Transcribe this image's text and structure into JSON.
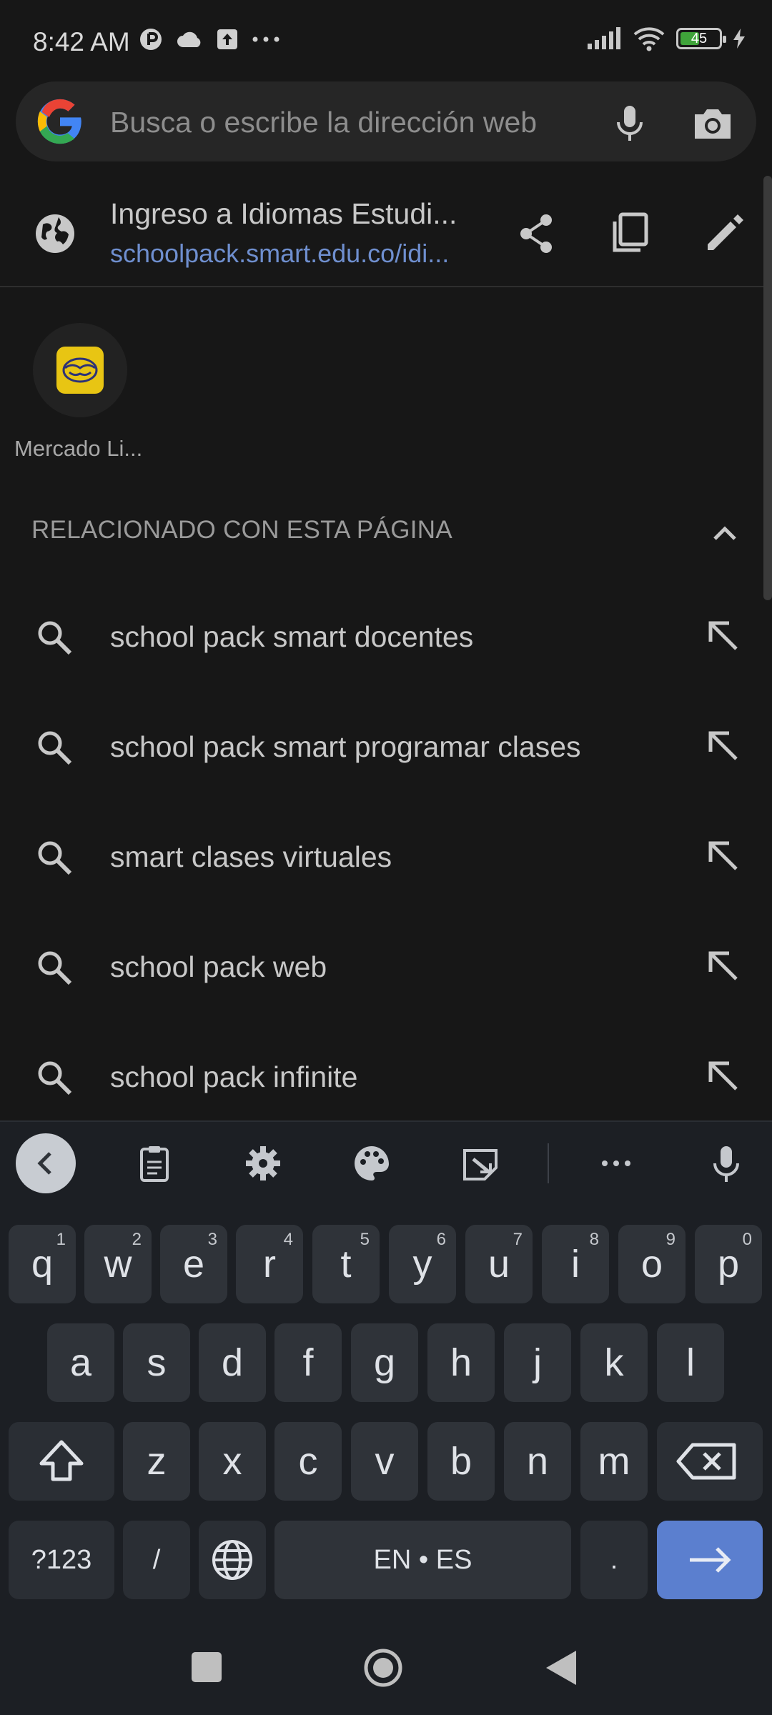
{
  "status_bar": {
    "time": "8:42 AM",
    "battery_percent": "45",
    "icons_left": [
      "privacy-icon",
      "cloud-icon",
      "upload-icon",
      "more-icon"
    ],
    "icons_right": [
      "signal-icon",
      "wifi-icon",
      "battery-icon",
      "charging-icon"
    ]
  },
  "search": {
    "placeholder": "Busca o escribe la dirección web"
  },
  "current_page": {
    "title": "Ingreso a Idiomas Estudi...",
    "url": "schoolpack.smart.edu.co/idi..."
  },
  "tiles": [
    {
      "label": "Mercado Li...",
      "color": "#e8c513"
    }
  ],
  "section": {
    "title": "RELACIONADO CON ESTA PÁGINA"
  },
  "suggestions": [
    {
      "text": "school pack smart docentes"
    },
    {
      "text": "school pack smart programar clases"
    },
    {
      "text": "smart clases virtuales"
    },
    {
      "text": "school pack web"
    },
    {
      "text": "school pack infinite"
    }
  ],
  "keyboard": {
    "row1": [
      {
        "k": "q",
        "s": "1"
      },
      {
        "k": "w",
        "s": "2"
      },
      {
        "k": "e",
        "s": "3"
      },
      {
        "k": "r",
        "s": "4"
      },
      {
        "k": "t",
        "s": "5"
      },
      {
        "k": "y",
        "s": "6"
      },
      {
        "k": "u",
        "s": "7"
      },
      {
        "k": "i",
        "s": "8"
      },
      {
        "k": "o",
        "s": "9"
      },
      {
        "k": "p",
        "s": "0"
      }
    ],
    "row2": [
      "a",
      "s",
      "d",
      "f",
      "g",
      "h",
      "j",
      "k",
      "l"
    ],
    "row3": [
      "z",
      "x",
      "c",
      "v",
      "b",
      "n",
      "m"
    ],
    "symbols_label": "?123",
    "slash_label": "/",
    "space_label": "EN • ES",
    "period_label": ".",
    "enter_color": "#5b7fcf"
  }
}
